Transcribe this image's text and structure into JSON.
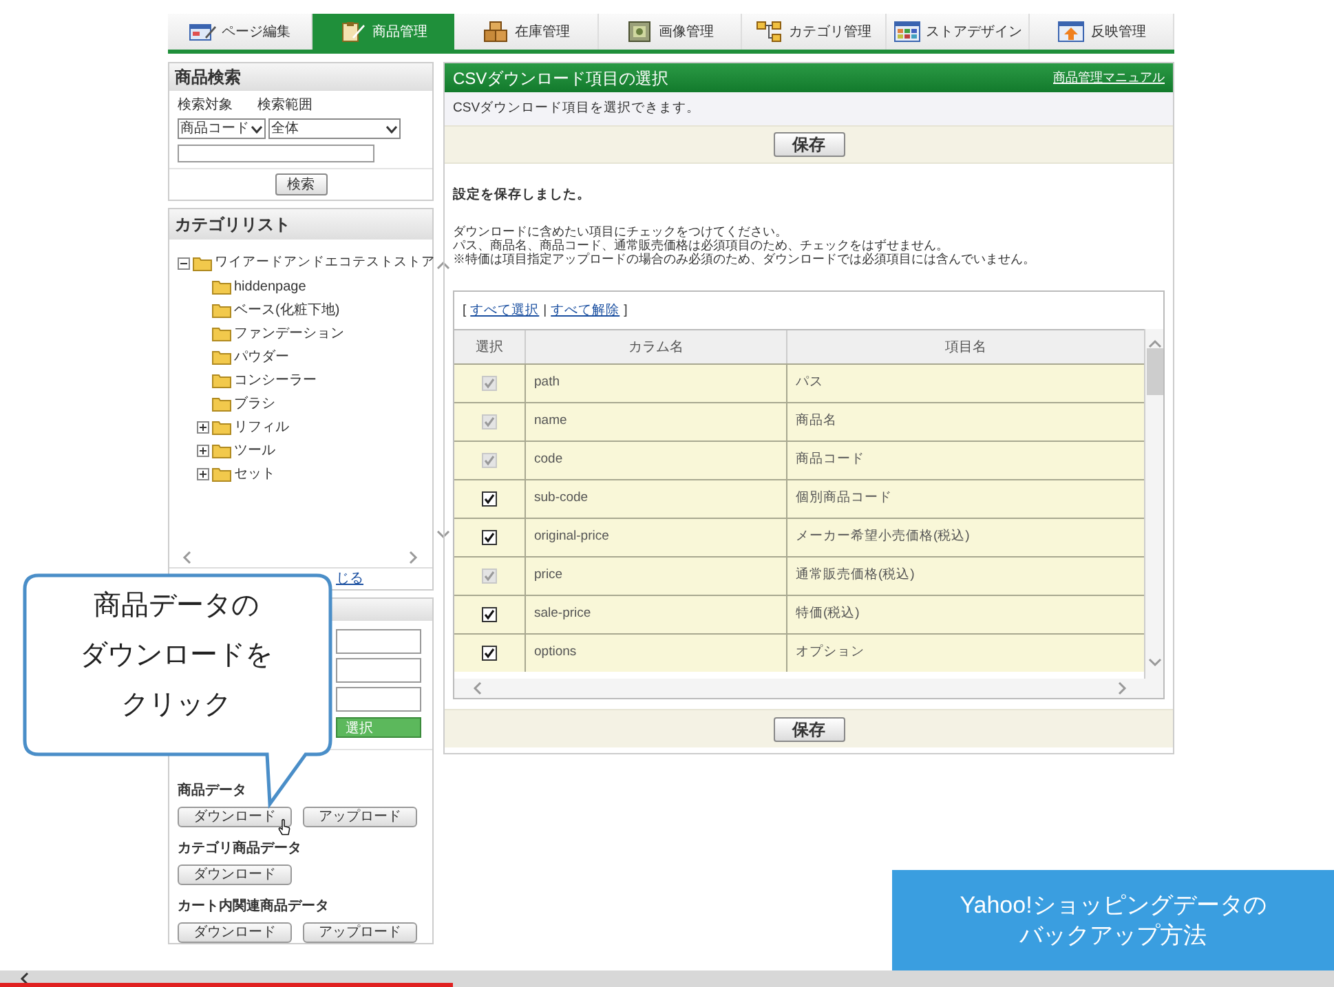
{
  "tabs": [
    {
      "label": "ページ編集",
      "selected": false
    },
    {
      "label": "商品管理",
      "selected": true
    },
    {
      "label": "在庫管理",
      "selected": false
    },
    {
      "label": "画像管理",
      "selected": false
    },
    {
      "label": "カテゴリ管理",
      "selected": false
    },
    {
      "label": "ストアデザイン",
      "selected": false
    },
    {
      "label": "反映管理",
      "selected": false
    }
  ],
  "search_panel": {
    "title": "商品検索",
    "target_label": "検索対象",
    "range_label": "検索範囲",
    "target_select": "商品コード",
    "range_select": "全体",
    "button": "検索"
  },
  "category_panel": {
    "title": "カテゴリリスト",
    "tree": [
      {
        "label": "ワイアードアンドエコテストストア",
        "expanded": true,
        "children": [
          {
            "label": "hiddenpage"
          },
          {
            "label": "ベース(化粧下地)"
          },
          {
            "label": "ファンデーション"
          },
          {
            "label": "パウダー"
          },
          {
            "label": "コンシーラー"
          },
          {
            "label": "ブラシ"
          },
          {
            "label": "リフィル",
            "expanded": false
          },
          {
            "label": "ツール",
            "expanded": false
          },
          {
            "label": "セット",
            "expanded": false
          }
        ]
      }
    ],
    "close_link": "じる"
  },
  "data_panel": {
    "select_button": "選択",
    "sections": [
      {
        "title": "商品データ",
        "buttons": [
          "ダウンロード",
          "アップロード"
        ]
      },
      {
        "title": "カテゴリ商品データ",
        "buttons": [
          "ダウンロード"
        ]
      },
      {
        "title": "カート内関連商品データ",
        "buttons": [
          "ダウンロード",
          "アップロード"
        ]
      }
    ]
  },
  "main": {
    "title": "CSVダウンロード項目の選択",
    "manual_link": "商品管理マニュアル",
    "description": "CSVダウンロード項目を選択できます。",
    "save_button": "保存",
    "message": "設定を保存しました。",
    "instructions": [
      "ダウンロードに含めたい項目にチェックをつけてください。",
      "パス、商品名、商品コード、通常販売価格は必須項目のため、チェックをはずせません。",
      "※特価は項目指定アップロードの場合のみ必須のため、ダウンロードでは必須項目には含んでいません。"
    ],
    "bracket_open": "[",
    "select_all": "すべて選択",
    "separator": "|",
    "deselect_all": "すべて解除",
    "bracket_close": "]",
    "table": {
      "columns": [
        "選択",
        "カラム名",
        "項目名"
      ],
      "rows": [
        {
          "checked": true,
          "disabled": true,
          "column": "path",
          "item": "パス"
        },
        {
          "checked": true,
          "disabled": true,
          "column": "name",
          "item": "商品名"
        },
        {
          "checked": true,
          "disabled": true,
          "column": "code",
          "item": "商品コード"
        },
        {
          "checked": true,
          "disabled": false,
          "column": "sub-code",
          "item": "個別商品コード"
        },
        {
          "checked": true,
          "disabled": false,
          "column": "original-price",
          "item": "メーカー希望小売価格(税込)"
        },
        {
          "checked": true,
          "disabled": true,
          "column": "price",
          "item": "通常販売価格(税込)"
        },
        {
          "checked": true,
          "disabled": false,
          "column": "sale-price",
          "item": "特価(税込)"
        },
        {
          "checked": true,
          "disabled": false,
          "column": "options",
          "item": "オプション"
        }
      ]
    },
    "bottom_save_button": "保存"
  },
  "callout": {
    "lines": [
      "商品データの",
      "ダウンロードを",
      "クリック"
    ]
  },
  "banner": {
    "lines": [
      "Yahoo!ショッピングデータの",
      "バックアップ方法"
    ]
  },
  "video_progress": {
    "level": 0.34
  }
}
